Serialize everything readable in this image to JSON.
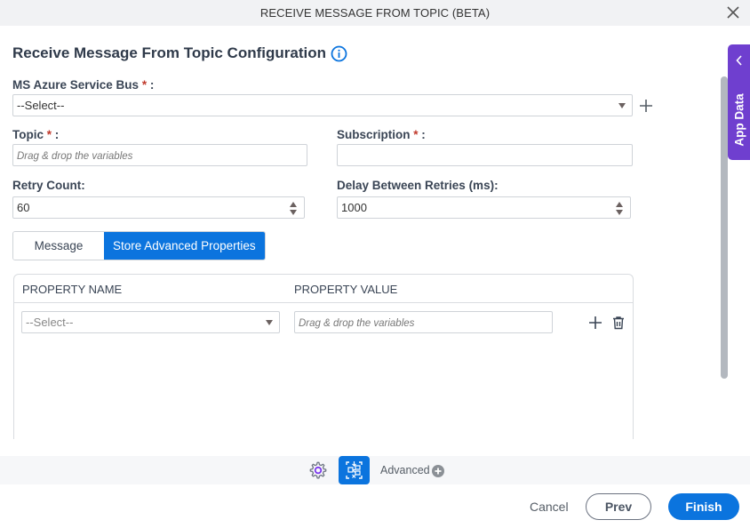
{
  "window": {
    "title": "RECEIVE MESSAGE FROM TOPIC (BETA)"
  },
  "page": {
    "title": "Receive Message From Topic Configuration"
  },
  "form": {
    "service_bus": {
      "label": "MS Azure Service Bus",
      "required_mark": "*",
      "suffix": " :",
      "value": "--Select--"
    },
    "topic": {
      "label": "Topic",
      "required_mark": "*",
      "suffix": " :",
      "placeholder": "Drag & drop the variables",
      "value": ""
    },
    "subscription": {
      "label": "Subscription",
      "required_mark": "*",
      "suffix": " :",
      "value": ""
    },
    "retry_count": {
      "label": "Retry Count:",
      "value": "60"
    },
    "delay": {
      "label": "Delay Between Retries (ms):",
      "value": "1000"
    }
  },
  "tabs": [
    {
      "label": "Message",
      "active": false
    },
    {
      "label": "Store Advanced Properties",
      "active": true
    }
  ],
  "grid": {
    "columns": [
      "PROPERTY NAME",
      "PROPERTY VALUE"
    ],
    "rows": [
      {
        "name": "--Select--",
        "value_placeholder": "Drag & drop the variables"
      }
    ]
  },
  "side_panel": {
    "label": "App Data"
  },
  "toolbar": {
    "advanced_label": "Advanced"
  },
  "footer": {
    "cancel_label": "Cancel",
    "prev_label": "Prev",
    "finish_label": "Finish"
  },
  "colors": {
    "accent": "#0b74de",
    "app_data": "#6f3fcf",
    "required": "#c0392b"
  }
}
